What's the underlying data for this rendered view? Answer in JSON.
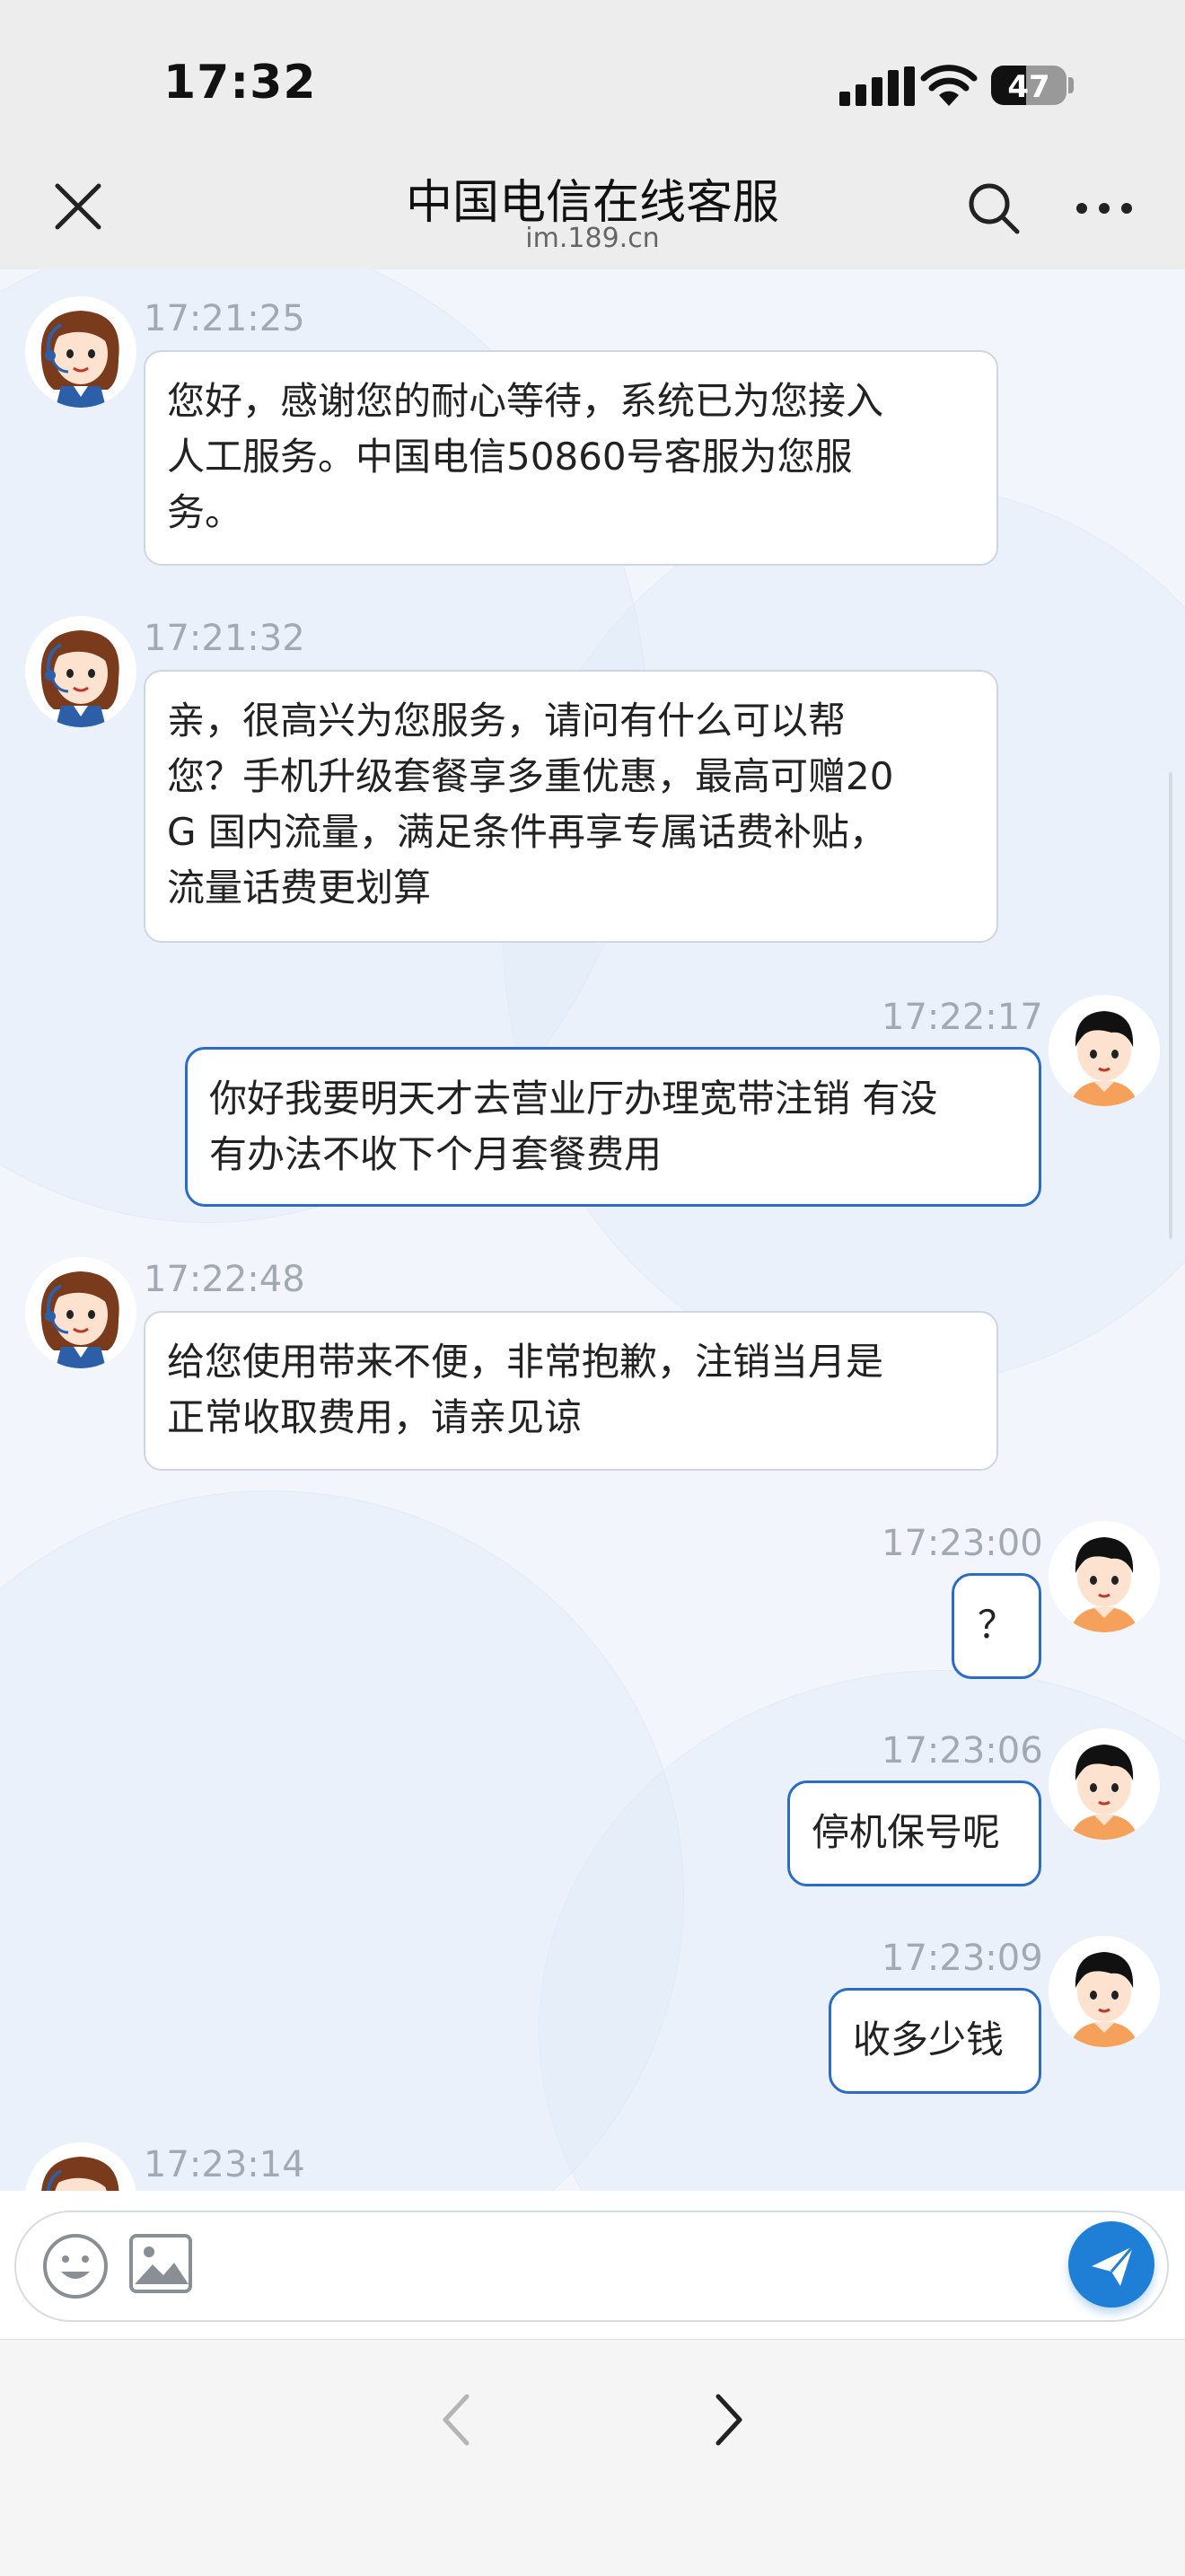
{
  "status_bar": {
    "time": "17:32",
    "battery": "47",
    "battery_level": 0.47
  },
  "header": {
    "title": "中国电信在线客服",
    "subtitle": "im.189.cn"
  },
  "messages": [
    {
      "sender": "agent",
      "time": "17:21:25",
      "lines": [
        "您好，感谢您的耐心等待，系统已为您接入",
        "人工服务。中国电信50860号客服为您服",
        "务。"
      ]
    },
    {
      "sender": "agent",
      "time": "17:21:32",
      "lines": [
        "亲，很高兴为您服务，请问有什么可以帮",
        "您？手机升级套餐享多重优惠，最高可赠20",
        "G 国内流量，满足条件再享专属话费补贴，",
        "流量话费更划算"
      ]
    },
    {
      "sender": "user",
      "time": "17:22:17",
      "lines": [
        "你好我要明天才去营业厅办理宽带注销 有没",
        "有办法不收下个月套餐费用"
      ]
    },
    {
      "sender": "agent",
      "time": "17:22:48",
      "lines": [
        "给您使用带来不便，非常抱歉，注销当月是",
        "正常收取费用，请亲见谅"
      ]
    },
    {
      "sender": "user",
      "time": "17:23:00",
      "lines": [
        "？"
      ]
    },
    {
      "sender": "user",
      "time": "17:23:06",
      "lines": [
        "停机保号呢"
      ]
    },
    {
      "sender": "user",
      "time": "17:23:09",
      "lines": [
        "收多少钱"
      ]
    },
    {
      "sender": "agent",
      "time": "17:23:14",
      "lines": []
    }
  ],
  "icons": {
    "close": "close-icon",
    "search": "search-icon",
    "more": "more-icon",
    "emoji": "emoji-icon",
    "image": "image-icon",
    "send": "send-icon",
    "back": "chevron-left-icon",
    "forward": "chevron-right-icon"
  },
  "colors": {
    "accent": "#2a6cc7",
    "send": "#1f7fd6"
  }
}
